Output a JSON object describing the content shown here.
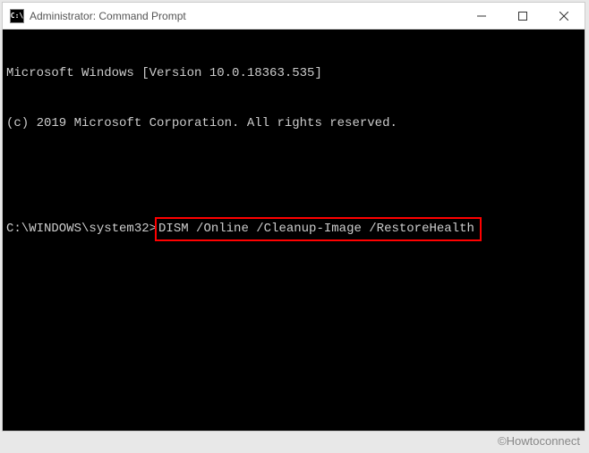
{
  "window": {
    "title": "Administrator: Command Prompt",
    "icon_label": "C:\\"
  },
  "terminal": {
    "line1": "Microsoft Windows [Version 10.0.18363.535]",
    "line2": "(c) 2019 Microsoft Corporation. All rights reserved.",
    "prompt": "C:\\WINDOWS\\system32>",
    "command": "DISM /Online /Cleanup-Image /RestoreHealth"
  },
  "watermark": "©Howtoconnect"
}
